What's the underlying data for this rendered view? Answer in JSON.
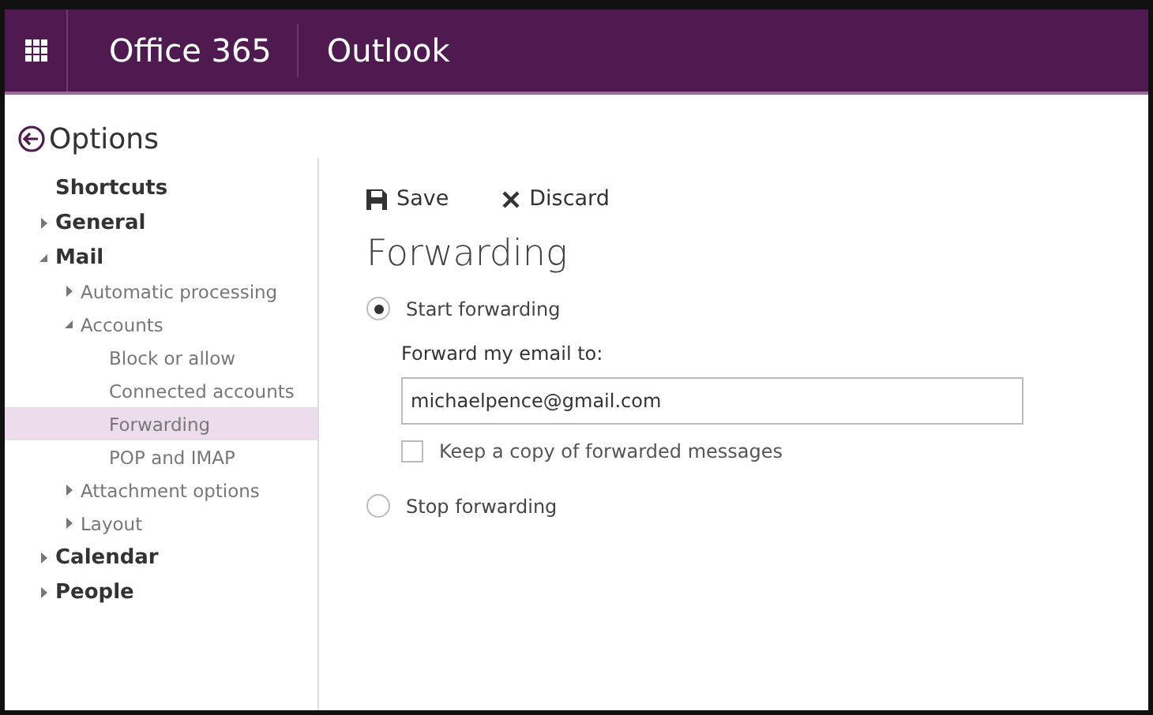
{
  "header": {
    "brand": "Office 365",
    "app": "Outlook"
  },
  "options": {
    "title": "Options"
  },
  "sidebar": {
    "items": [
      {
        "label": "Shortcuts",
        "kind": "page",
        "selected": false
      },
      {
        "label": "General",
        "kind": "folder",
        "expanded": false,
        "selected": false
      },
      {
        "label": "Mail",
        "kind": "folder",
        "expanded": true,
        "selected": false,
        "children": [
          {
            "label": "Automatic processing",
            "kind": "folder",
            "expanded": false,
            "selected": false
          },
          {
            "label": "Accounts",
            "kind": "folder",
            "expanded": true,
            "selected": false,
            "children": [
              {
                "label": "Block or allow",
                "kind": "page",
                "selected": false
              },
              {
                "label": "Connected accounts",
                "kind": "page",
                "selected": false
              },
              {
                "label": "Forwarding",
                "kind": "page",
                "selected": true
              },
              {
                "label": "POP and IMAP",
                "kind": "page",
                "selected": false
              }
            ]
          },
          {
            "label": "Attachment options",
            "kind": "folder",
            "expanded": false,
            "selected": false
          },
          {
            "label": "Layout",
            "kind": "folder",
            "expanded": false,
            "selected": false
          }
        ]
      },
      {
        "label": "Calendar",
        "kind": "folder",
        "expanded": false,
        "selected": false
      },
      {
        "label": "People",
        "kind": "folder",
        "expanded": false,
        "selected": false
      }
    ]
  },
  "toolbar": {
    "save": "Save",
    "discard": "Discard"
  },
  "content": {
    "title": "Forwarding",
    "start_option": {
      "label": "Start forwarding",
      "selected": true
    },
    "forward_label": "Forward my email to:",
    "forward_field": {
      "value": "michaelpence@gmail.com"
    },
    "keep_copy": {
      "label": "Keep a copy of forwarded messages",
      "checked": false
    },
    "stop_option": {
      "label": "Stop forwarding",
      "selected": false
    }
  }
}
